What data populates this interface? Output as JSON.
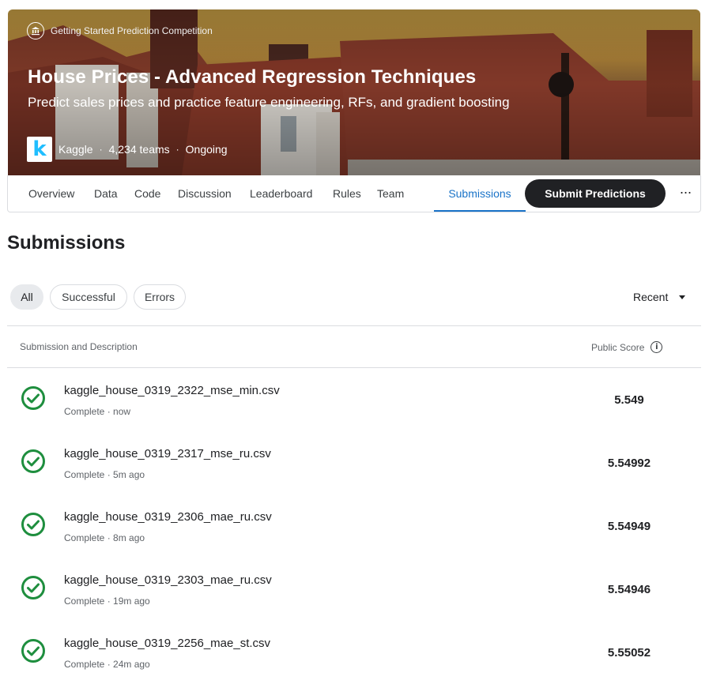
{
  "hero": {
    "competition_type": "Getting Started Prediction Competition",
    "type_icon": "bank-icon",
    "title": "House Prices - Advanced Regression Techniques",
    "subtitle": "Predict sales prices and practice feature engineering, RFs, and gradient boosting",
    "host_logo_letter": "k",
    "host": "Kaggle",
    "teams": "4,234 teams",
    "status": "Ongoing"
  },
  "tabs": [
    "Overview",
    "Data",
    "Code",
    "Discussion",
    "Leaderboard",
    "Rules",
    "Team",
    "Submissions"
  ],
  "active_tab": "Submissions",
  "submit_button": "Submit Predictions",
  "more_button": "···",
  "page_title": "Submissions",
  "filters": [
    "All",
    "Successful",
    "Errors"
  ],
  "active_filter": "All",
  "sort": "Recent",
  "table": {
    "col_left": "Submission and Description",
    "col_right": "Public Score",
    "info_icon": "i",
    "rows": [
      {
        "file": "kaggle_house_0319_2322_mse_min.csv",
        "status": "Complete · now",
        "score": "5.549"
      },
      {
        "file": "kaggle_house_0319_2317_mse_ru.csv",
        "status": "Complete · 5m ago",
        "score": "5.54992"
      },
      {
        "file": "kaggle_house_0319_2306_mae_ru.csv",
        "status": "Complete · 8m ago",
        "score": "5.54949"
      },
      {
        "file": "kaggle_house_0319_2303_mae_ru.csv",
        "status": "Complete · 19m ago",
        "score": "5.54946"
      },
      {
        "file": "kaggle_house_0319_2256_mae_st.csv",
        "status": "Complete · 24m ago",
        "score": "5.55052"
      }
    ]
  },
  "colors": {
    "accent": "#1a73c8",
    "success": "#1e8e3e",
    "dark_button": "#202124"
  }
}
